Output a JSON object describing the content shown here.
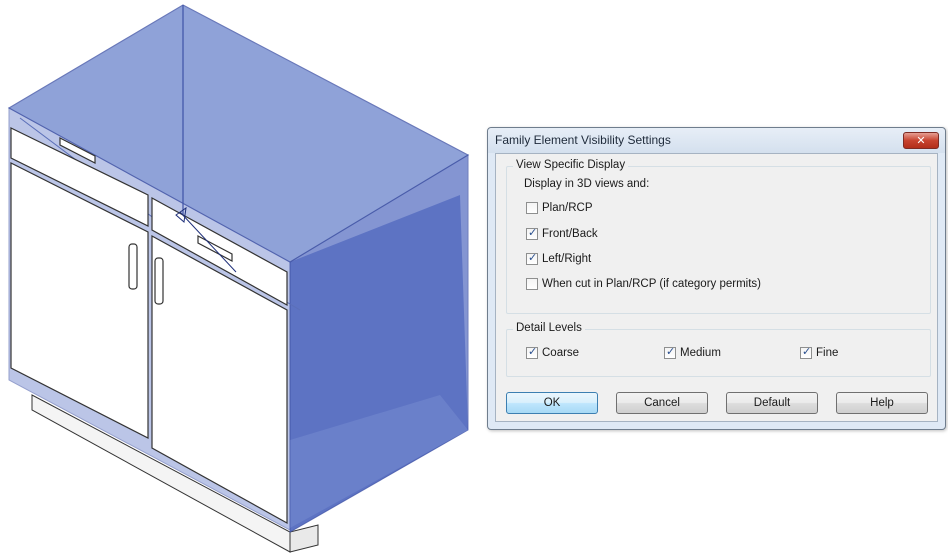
{
  "dialog": {
    "title": "Family Element Visibility Settings",
    "close_glyph": "✕",
    "view_specific": {
      "legend": "View Specific Display",
      "intro": "Display in 3D views and:",
      "options": [
        {
          "label": "Plan/RCP",
          "checked": false
        },
        {
          "label": "Front/Back",
          "checked": true
        },
        {
          "label": "Left/Right",
          "checked": true
        },
        {
          "label": "When cut in Plan/RCP (if category permits)",
          "checked": false
        }
      ]
    },
    "detail_levels": {
      "legend": "Detail Levels",
      "options": [
        {
          "label": "Coarse",
          "checked": true
        },
        {
          "label": "Medium",
          "checked": true
        },
        {
          "label": "Fine",
          "checked": true
        }
      ]
    },
    "buttons": {
      "ok": "OK",
      "cancel": "Cancel",
      "default": "Default",
      "help": "Help"
    }
  },
  "annotation": {
    "arrow_color": "#c0282d"
  },
  "colors": {
    "selection_fill": "#5b72c4",
    "selection_edge": "#3f53a6",
    "cabinet_fill": "#ffffff",
    "cabinet_edge": "#333333"
  }
}
